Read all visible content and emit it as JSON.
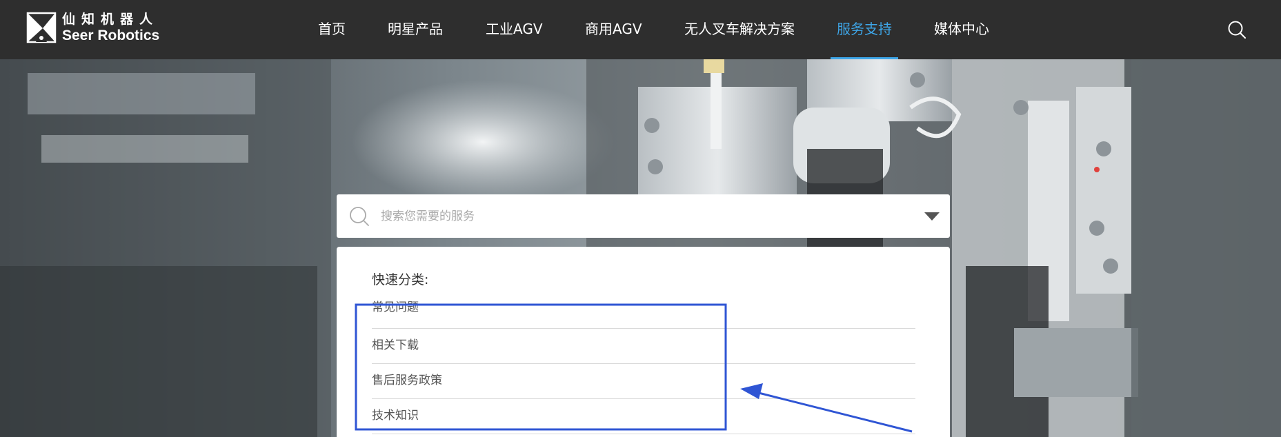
{
  "header": {
    "logo": {
      "cn": "仙知机器人",
      "en": "Seer Robotics"
    },
    "nav": [
      {
        "label": "首页",
        "active": false
      },
      {
        "label": "明星产品",
        "active": false
      },
      {
        "label": "工业AGV",
        "active": false
      },
      {
        "label": "商用AGV",
        "active": false
      },
      {
        "label": "无人叉车解决方案",
        "active": false
      },
      {
        "label": "服务支持",
        "active": true
      },
      {
        "label": "媒体中心",
        "active": false
      }
    ],
    "search_icon": "search-icon"
  },
  "search": {
    "placeholder": "搜索您需要的服务",
    "value": "",
    "icon": "search-icon",
    "dropdown_icon": "caret-down-icon"
  },
  "quick_categories": {
    "title": "快速分类:",
    "items": [
      {
        "label": "常见问题"
      },
      {
        "label": "相关下载"
      },
      {
        "label": "售后服务政策"
      },
      {
        "label": "技术知识"
      }
    ]
  },
  "annotation": {
    "box_color": "#2f55d4",
    "arrow_color": "#2f55d4"
  },
  "colors": {
    "header_bg": "#2e2e2e",
    "accent": "#3ea6e8",
    "text_white": "#ffffff"
  }
}
